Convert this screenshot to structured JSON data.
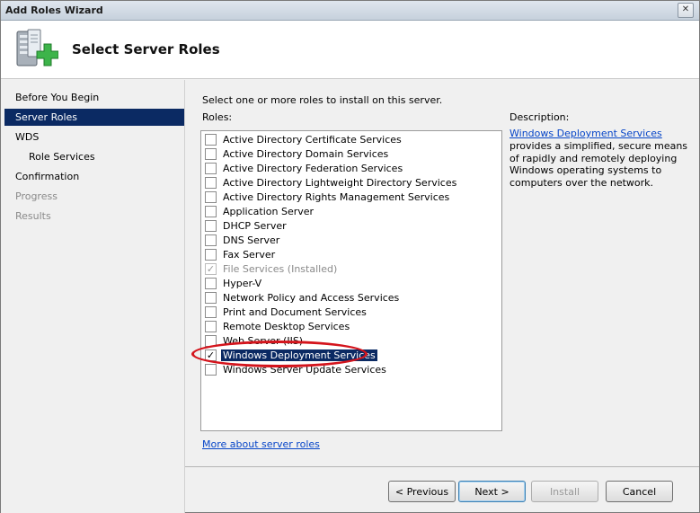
{
  "window": {
    "title": "Add Roles Wizard",
    "close_glyph": "✕"
  },
  "header": {
    "title": "Select Server Roles",
    "icon": "server-add-icon"
  },
  "sidebar": {
    "items": [
      {
        "label": "Before You Begin",
        "state": "normal"
      },
      {
        "label": "Server Roles",
        "state": "active"
      },
      {
        "label": "WDS",
        "state": "normal"
      },
      {
        "label": "Role Services",
        "state": "normal",
        "indent": true
      },
      {
        "label": "Confirmation",
        "state": "normal"
      },
      {
        "label": "Progress",
        "state": "disabled"
      },
      {
        "label": "Results",
        "state": "disabled"
      }
    ]
  },
  "main": {
    "instruction": "Select one or more roles to install on this server.",
    "roles_label": "Roles:",
    "roles": [
      {
        "label": "Active Directory Certificate Services",
        "checked": false
      },
      {
        "label": "Active Directory Domain Services",
        "checked": false
      },
      {
        "label": "Active Directory Federation Services",
        "checked": false
      },
      {
        "label": "Active Directory Lightweight Directory Services",
        "checked": false
      },
      {
        "label": "Active Directory Rights Management Services",
        "checked": false
      },
      {
        "label": "Application Server",
        "checked": false
      },
      {
        "label": "DHCP Server",
        "checked": false
      },
      {
        "label": "DNS Server",
        "checked": false
      },
      {
        "label": "Fax Server",
        "checked": false
      },
      {
        "label": "File Services  (Installed)",
        "checked": true,
        "disabled": true
      },
      {
        "label": "Hyper-V",
        "checked": false
      },
      {
        "label": "Network Policy and Access Services",
        "checked": false
      },
      {
        "label": "Print and Document Services",
        "checked": false
      },
      {
        "label": "Remote Desktop Services",
        "checked": false
      },
      {
        "label": "Web Server (IIS)",
        "checked": false
      },
      {
        "label": "Windows Deployment Services",
        "checked": true,
        "selected": true
      },
      {
        "label": "Windows Server Update Services",
        "checked": false
      }
    ],
    "more_link": "More about server roles"
  },
  "description": {
    "title": "Description:",
    "link": "Windows Deployment Services",
    "text": "provides a simplified, secure means of rapidly and remotely deploying Windows operating systems to computers over the network."
  },
  "buttons": {
    "previous": "< Previous",
    "next": "Next >",
    "install": "Install",
    "cancel": "Cancel"
  },
  "colors": {
    "selection": "#0b2a63",
    "link": "#0645c8",
    "annotation": "#d4141c"
  }
}
